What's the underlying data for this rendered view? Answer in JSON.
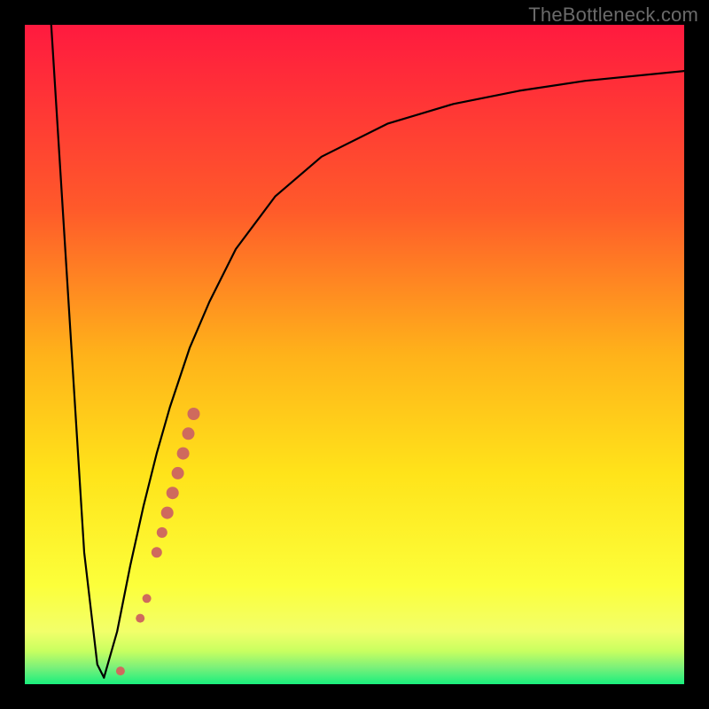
{
  "watermark": "TheBottleneck.com",
  "colors": {
    "frame": "#000000",
    "curve": "#000000",
    "marker": "#cf6a5d",
    "grad_top": "#ff1a3f",
    "grad_mid1": "#ff8a1f",
    "grad_mid2": "#ffe31a",
    "grad_mid3": "#fbff4d",
    "grad_bot": "#19ef7d"
  },
  "chart_data": {
    "type": "line",
    "title": "",
    "xlabel": "",
    "ylabel": "",
    "xlim": [
      0,
      100
    ],
    "ylim": [
      0,
      100
    ],
    "series": [
      {
        "name": "left-branch",
        "x": [
          4,
          9,
          11,
          12
        ],
        "y": [
          100,
          20,
          3,
          1
        ]
      },
      {
        "name": "right-branch",
        "x": [
          12,
          14,
          16,
          18,
          20,
          22,
          25,
          28,
          32,
          38,
          45,
          55,
          65,
          75,
          85,
          100
        ],
        "y": [
          1,
          8,
          18,
          27,
          35,
          42,
          51,
          58,
          66,
          74,
          80,
          85,
          88,
          90,
          91.5,
          93
        ]
      }
    ],
    "markers": [
      {
        "x": 14.5,
        "y": 2.0,
        "r": 5
      },
      {
        "x": 17.5,
        "y": 10.0,
        "r": 5
      },
      {
        "x": 18.5,
        "y": 13.0,
        "r": 5
      },
      {
        "x": 20.0,
        "y": 20.0,
        "r": 6
      },
      {
        "x": 20.8,
        "y": 23.0,
        "r": 6
      },
      {
        "x": 21.6,
        "y": 26.0,
        "r": 7
      },
      {
        "x": 22.4,
        "y": 29.0,
        "r": 7
      },
      {
        "x": 23.2,
        "y": 32.0,
        "r": 7
      },
      {
        "x": 24.0,
        "y": 35.0,
        "r": 7
      },
      {
        "x": 24.8,
        "y": 38.0,
        "r": 7
      },
      {
        "x": 25.6,
        "y": 41.0,
        "r": 7
      }
    ]
  }
}
